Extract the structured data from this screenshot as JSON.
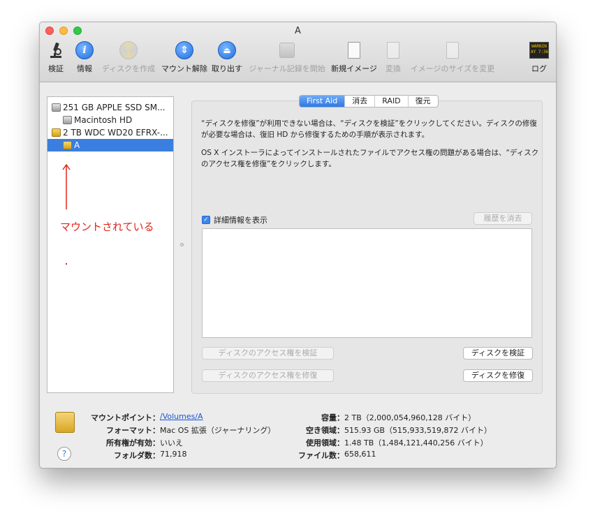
{
  "window": {
    "title": "A"
  },
  "toolbar": {
    "items": [
      {
        "label": "検証",
        "icon": "microscope-icon",
        "enabled": true
      },
      {
        "label": "情報",
        "icon": "info-icon",
        "enabled": true
      },
      {
        "label": "ディスクを作成",
        "icon": "burn-disc-icon",
        "enabled": false
      },
      {
        "label": "マウント解除",
        "icon": "unmount-icon",
        "enabled": true
      },
      {
        "label": "取り出す",
        "icon": "eject-icon",
        "enabled": true
      },
      {
        "label": "ジャーナル記録を開始",
        "icon": "enable-journaling-icon",
        "enabled": false
      },
      {
        "label": "新規イメージ",
        "icon": "new-image-icon",
        "enabled": true
      },
      {
        "label": "変換",
        "icon": "convert-icon",
        "enabled": false
      },
      {
        "label": "イメージのサイズを変更",
        "icon": "resize-image-icon",
        "enabled": false
      },
      {
        "label": "ログ",
        "icon": "log-icon",
        "enabled": true
      }
    ],
    "log_icon_text": "WARNIN\nAY 7:36"
  },
  "sidebar": {
    "disks": [
      {
        "label": "251 GB APPLE SSD SM...",
        "kind": "internal",
        "indent": 0,
        "selected": false
      },
      {
        "label": "Macintosh HD",
        "kind": "internal",
        "indent": 1,
        "selected": false
      },
      {
        "label": "2 TB WDC WD20 EFRX-...",
        "kind": "external",
        "indent": 0,
        "selected": false
      },
      {
        "label": "A",
        "kind": "external",
        "indent": 1,
        "selected": true
      }
    ]
  },
  "annotation": {
    "text": "マウントされている",
    "color": "#e0241b"
  },
  "tabs": [
    {
      "label": "First Aid",
      "active": true
    },
    {
      "label": "消去",
      "active": false
    },
    {
      "label": "RAID",
      "active": false
    },
    {
      "label": "復元",
      "active": false
    }
  ],
  "first_aid": {
    "paragraph1": "“ディスクを修復”が利用できない場合は、“ディスクを検証”をクリックしてください。ディスクの修復が必要な場合は、復旧 HD から修復するための手順が表示されます。",
    "paragraph2": "OS X インストーラによってインストールされたファイルでアクセス権の問題がある場合は、“ディスクのアクセス権を修復”をクリックします。",
    "show_details_label": "詳細情報を表示",
    "show_details_checked": true,
    "clear_history_label": "履歴を消去",
    "verify_permissions_label": "ディスクのアクセス権を検証",
    "repair_permissions_label": "ディスクのアクセス権を修復",
    "verify_disk_label": "ディスクを検証",
    "repair_disk_label": "ディスクを修復"
  },
  "info": {
    "left": [
      {
        "key": "マウントポイント：",
        "value": "/Volumes/A",
        "link": true
      },
      {
        "key": "フォーマット：",
        "value": "Mac OS 拡張（ジャーナリング）",
        "link": false
      },
      {
        "key": "所有権が有効：",
        "value": "いいえ",
        "link": false
      },
      {
        "key": "フォルダ数：",
        "value": "71,918",
        "link": false
      }
    ],
    "right": [
      {
        "key": "容量：",
        "value": "2 TB（2,000,054,960,128 バイト）"
      },
      {
        "key": "空き領域：",
        "value": "515.93 GB（515,933,519,872 バイト）"
      },
      {
        "key": "使用領域：",
        "value": "1.48 TB（1,484,121,440,256 バイト）"
      },
      {
        "key": "ファイル数：",
        "value": "658,611"
      }
    ],
    "help_label": "?"
  },
  "colors": {
    "accent": "#3a7ee0",
    "selection": "#3a7ee0"
  }
}
